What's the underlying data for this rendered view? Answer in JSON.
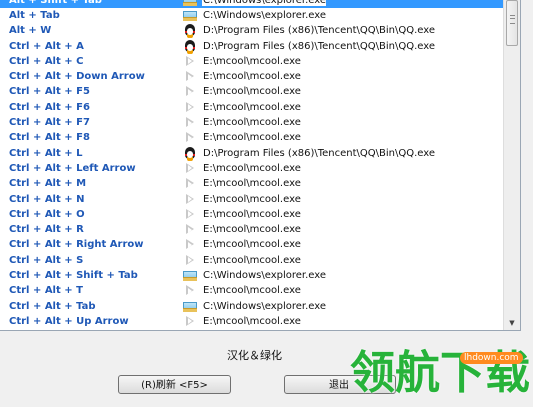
{
  "colors": {
    "hotkey_text": "#1f58b6",
    "selection": "#3399ff",
    "watermark": "#27b33a",
    "watermark_badge": "#ff8a1f"
  },
  "hotkeys": [
    {
      "key": "Alt + Shift + Tab",
      "icon": "folder-icon",
      "path": "C:\\Windows\\explorer.exe",
      "selected": true
    },
    {
      "key": "Alt + Tab",
      "icon": "folder-icon",
      "path": "C:\\Windows\\explorer.exe"
    },
    {
      "key": "Alt + W",
      "icon": "penguin-icon",
      "path": "D:\\Program Files (x86)\\Tencent\\QQ\\Bin\\QQ.exe"
    },
    {
      "key": "Ctrl + Alt + A",
      "icon": "penguin-icon",
      "path": "D:\\Program Files (x86)\\Tencent\\QQ\\Bin\\QQ.exe"
    },
    {
      "key": "Ctrl + Alt + C",
      "icon": "play-icon",
      "path": "E:\\mcool\\mcool.exe"
    },
    {
      "key": "Ctrl + Alt + Down Arrow",
      "icon": "play-icon",
      "path": "E:\\mcool\\mcool.exe"
    },
    {
      "key": "Ctrl + Alt + F5",
      "icon": "play-icon",
      "path": "E:\\mcool\\mcool.exe"
    },
    {
      "key": "Ctrl + Alt + F6",
      "icon": "play-icon",
      "path": "E:\\mcool\\mcool.exe"
    },
    {
      "key": "Ctrl + Alt + F7",
      "icon": "play-icon",
      "path": "E:\\mcool\\mcool.exe"
    },
    {
      "key": "Ctrl + Alt + F8",
      "icon": "play-icon",
      "path": "E:\\mcool\\mcool.exe"
    },
    {
      "key": "Ctrl + Alt + L",
      "icon": "penguin-icon",
      "path": "D:\\Program Files (x86)\\Tencent\\QQ\\Bin\\QQ.exe"
    },
    {
      "key": "Ctrl + Alt + Left Arrow",
      "icon": "play-icon",
      "path": "E:\\mcool\\mcool.exe"
    },
    {
      "key": "Ctrl + Alt + M",
      "icon": "play-icon",
      "path": "E:\\mcool\\mcool.exe"
    },
    {
      "key": "Ctrl + Alt + N",
      "icon": "play-icon",
      "path": "E:\\mcool\\mcool.exe"
    },
    {
      "key": "Ctrl + Alt + O",
      "icon": "play-icon",
      "path": "E:\\mcool\\mcool.exe"
    },
    {
      "key": "Ctrl + Alt + R",
      "icon": "play-icon",
      "path": "E:\\mcool\\mcool.exe"
    },
    {
      "key": "Ctrl + Alt + Right Arrow",
      "icon": "play-icon",
      "path": "E:\\mcool\\mcool.exe"
    },
    {
      "key": "Ctrl + Alt + S",
      "icon": "play-icon",
      "path": "E:\\mcool\\mcool.exe"
    },
    {
      "key": "Ctrl + Alt + Shift + Tab",
      "icon": "folder-icon",
      "path": "C:\\Windows\\explorer.exe"
    },
    {
      "key": "Ctrl + Alt + T",
      "icon": "play-icon",
      "path": "E:\\mcool\\mcool.exe"
    },
    {
      "key": "Ctrl + Alt + Tab",
      "icon": "folder-icon",
      "path": "C:\\Windows\\explorer.exe"
    },
    {
      "key": "Ctrl + Alt + Up Arrow",
      "icon": "play-icon",
      "path": "E:\\mcool\\mcool.exe"
    }
  ],
  "footer": {
    "credit": "汉化＆绿化",
    "refresh_label": "(R)刷新 <F5>",
    "exit_label": "退出"
  },
  "watermark": {
    "text": "领航下载",
    "url": "lhdown.com"
  },
  "icons": {
    "scroll_down": "scroll-down-arrow-icon"
  }
}
